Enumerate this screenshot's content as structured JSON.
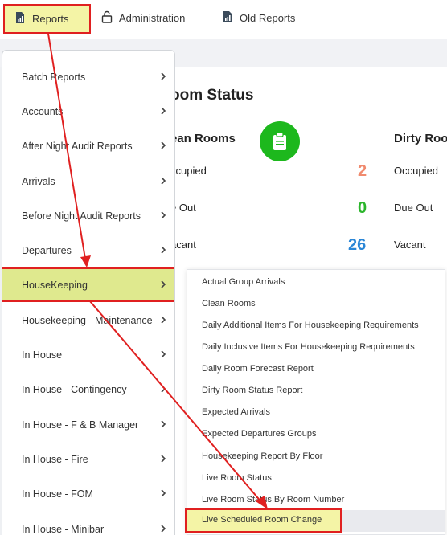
{
  "nav": {
    "reports_label": "Reports",
    "admin_label": "Administration",
    "old_reports_label": "Old Reports"
  },
  "room_status": {
    "title": "oom Status",
    "clean_heading": "ean Rooms",
    "dirty_heading": "Dirty Roo",
    "rows": [
      {
        "label": "ccupied",
        "value": "2",
        "dirty_label": "Occupied"
      },
      {
        "label": "e Out",
        "value": "0",
        "dirty_label": "Due Out"
      },
      {
        "label": "acant",
        "value": "26",
        "dirty_label": "Vacant"
      }
    ],
    "colors": {
      "occupied": "#f08a6e",
      "due_out": "#2bb52b",
      "vacant": "#2a86d6",
      "badge": "#1db81d"
    }
  },
  "menu": {
    "items": [
      {
        "label": "Batch Reports"
      },
      {
        "label": "Accounts"
      },
      {
        "label": "After Night Audit Reports"
      },
      {
        "label": "Arrivals"
      },
      {
        "label": "Before Night Audit Reports"
      },
      {
        "label": "Departures"
      },
      {
        "label": "HouseKeeping"
      },
      {
        "label": "Housekeeping - Maintenance"
      },
      {
        "label": "In House"
      },
      {
        "label": "In House - Contingency"
      },
      {
        "label": "In House - F & B Manager"
      },
      {
        "label": "In House - Fire"
      },
      {
        "label": "In House - FOM"
      },
      {
        "label": "In House - Minibar"
      }
    ]
  },
  "submenu": {
    "items": [
      {
        "label": "Actual Group Arrivals"
      },
      {
        "label": "Clean Rooms"
      },
      {
        "label": "Daily Additional Items For Housekeeping Requirements"
      },
      {
        "label": "Daily Inclusive Items For Housekeeping Requirements"
      },
      {
        "label": "Daily Room Forecast Report"
      },
      {
        "label": "Dirty Room Status Report"
      },
      {
        "label": "Expected Arrivals"
      },
      {
        "label": "Expected Departures Groups"
      },
      {
        "label": "Housekeeping Report By Floor"
      },
      {
        "label": "Live Room Status"
      },
      {
        "label": "Live Room Status By Room Number"
      },
      {
        "label": "Live Scheduled Room Change"
      }
    ]
  },
  "accent": {
    "highlight": "#f4f4a6",
    "menu_highlight": "#dfe98e",
    "annotation": "#e02020"
  }
}
